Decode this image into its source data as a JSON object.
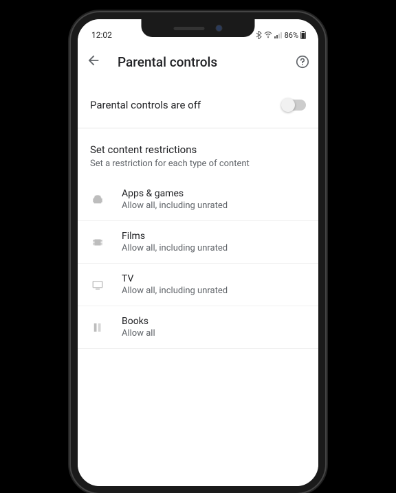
{
  "statusbar": {
    "time": "12:02",
    "battery": "86%"
  },
  "appbar": {
    "title": "Parental controls"
  },
  "toggle": {
    "label": "Parental controls are off",
    "enabled": false
  },
  "section": {
    "title": "Set content restrictions",
    "subtitle": "Set a restriction for each type of content"
  },
  "items": [
    {
      "title": "Apps & games",
      "subtitle": "Allow all, including unrated"
    },
    {
      "title": "Films",
      "subtitle": "Allow all, including unrated"
    },
    {
      "title": "TV",
      "subtitle": "Allow all, including unrated"
    },
    {
      "title": "Books",
      "subtitle": "Allow all"
    }
  ]
}
